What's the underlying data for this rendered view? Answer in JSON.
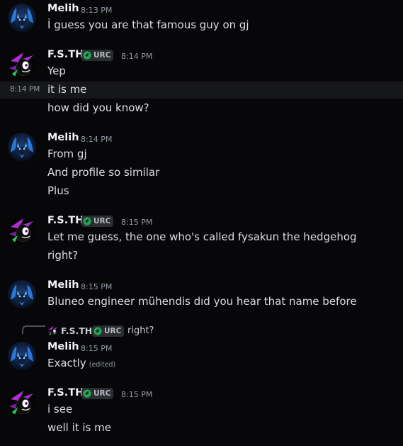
{
  "colors": {
    "background": "#070709",
    "name": "#f2f3f5",
    "text": "#dbdee1",
    "muted": "#949ba4",
    "tag_bg": "#2b2d31",
    "tag_icon": "#23a559",
    "fs_purple": "#b02cd6",
    "melih_blue": "#3a8cf2"
  },
  "users": {
    "melih": {
      "name": "Melih",
      "avatar_icon": "blue-wolf-avatar"
    },
    "fsth": {
      "name": "F.S.TH",
      "avatar_icon": "black-hedgehog-avatar",
      "tag": "URC",
      "tag_icon": "leaf-icon"
    }
  },
  "messages": [
    {
      "author": "Melih",
      "time": "8:13 PM",
      "lines": [
        "İ guess you are that famous guy on gj"
      ]
    },
    {
      "author": "F.S.TH",
      "tag": "URC",
      "time": "8:14 PM",
      "lines": [
        "Yep",
        "it is me",
        "how did you know?"
      ],
      "hover_time": "8:14 PM"
    },
    {
      "author": "Melih",
      "time": "8:14 PM",
      "lines": [
        "From gj",
        "And profile so similar",
        "Plus"
      ]
    },
    {
      "author": "F.S.TH",
      "tag": "URC",
      "time": "8:15 PM",
      "lines": [
        "Let me guess, the one who's called fysakun the hedgehog",
        "right?"
      ]
    },
    {
      "author": "Melih",
      "time": "8:15 PM",
      "lines": [
        "Bluneo engineer mühendis dıd you hear that name before"
      ]
    },
    {
      "author": "Melih",
      "time": "8:15 PM",
      "lines": [
        "Exactly"
      ],
      "edited": "(edited)",
      "reply": {
        "author": "F.S.TH",
        "tag": "URC",
        "text": "right?"
      }
    },
    {
      "author": "F.S.TH",
      "tag": "URC",
      "time": "8:15 PM",
      "lines": [
        "i see",
        "well it is me"
      ]
    }
  ]
}
